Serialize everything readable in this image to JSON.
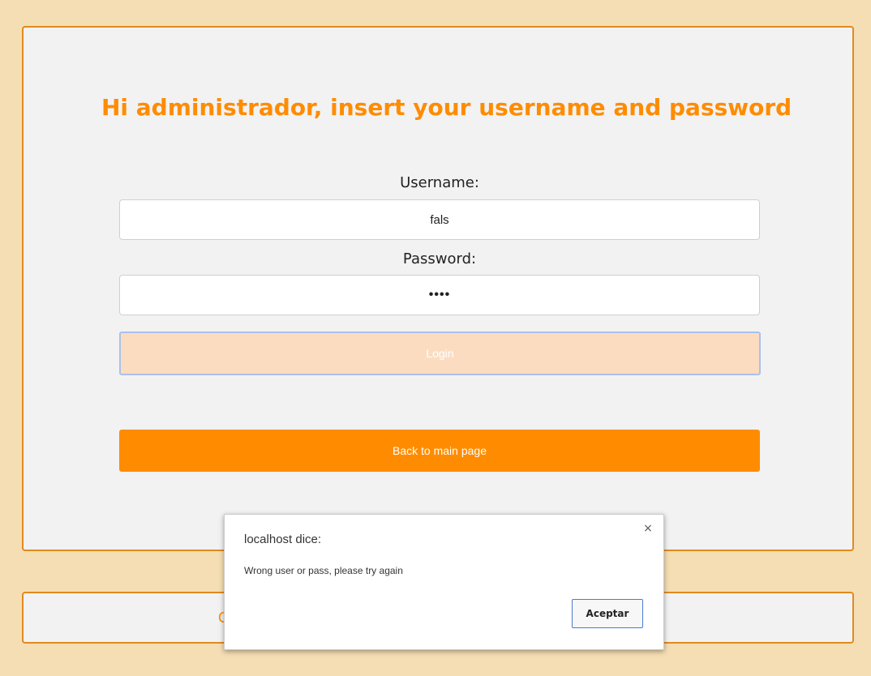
{
  "login": {
    "title": "Hi administrador, insert your username and password",
    "username_label": "Username:",
    "username_value": "fals",
    "password_label": "Password:",
    "password_value": "••••",
    "login_label": "Login",
    "back_label": "Back to main page"
  },
  "footer": {
    "partial_text": "C"
  },
  "dialog": {
    "title": "localhost dice:",
    "message": "Wrong user or pass, please try again",
    "ok_label": "Aceptar",
    "close_symbol": "×"
  },
  "colors": {
    "accent": "#ff8c00",
    "page_background": "#f5deb3",
    "panel_background": "#f2f2f2",
    "login_button_disabled": "#fcdcc1"
  }
}
